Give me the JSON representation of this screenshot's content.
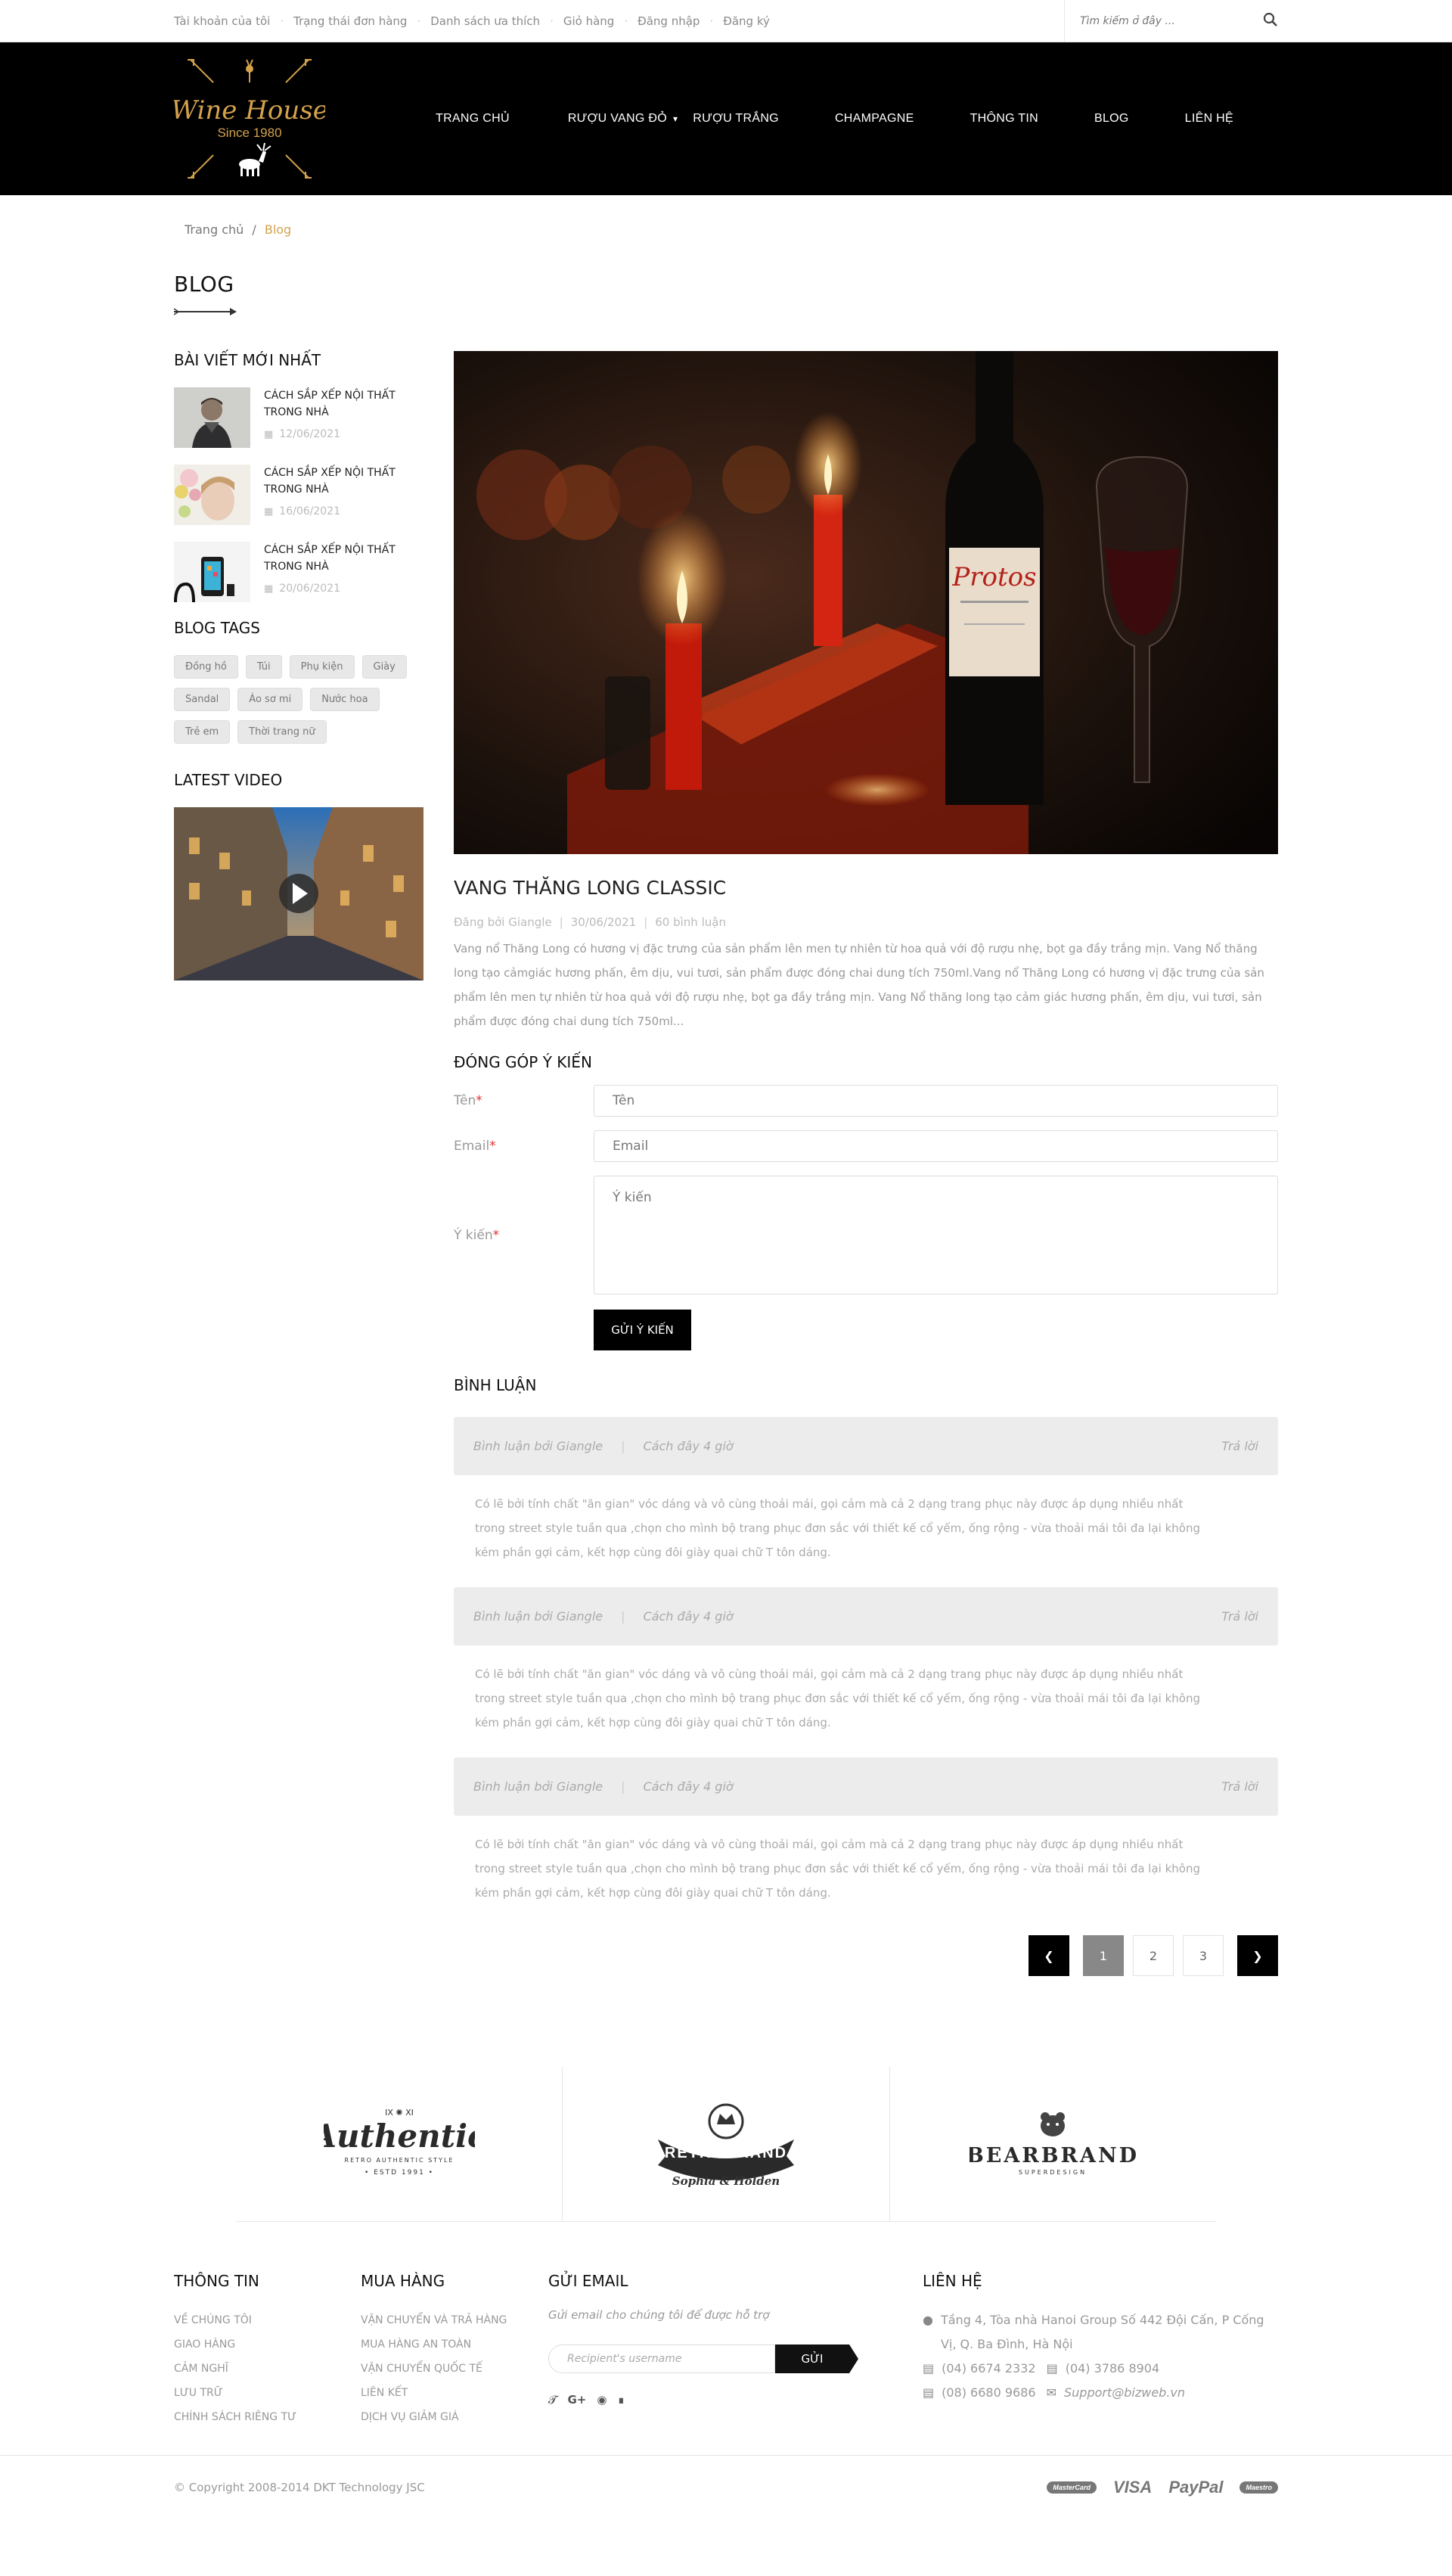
{
  "topbar": {
    "links": [
      "Tài khoản của tôi",
      "Trạng thái đơn hàng",
      "Danh sách ưa thích",
      "Giỏ hàng",
      "Đăng nhập",
      "Đăng ký"
    ],
    "search_placeholder": "Tìm kiếm ở đây ..."
  },
  "logo": {
    "name": "Wine House",
    "since": "Since 1980"
  },
  "nav": [
    "TRANG CHỦ",
    "RƯỢU VANG ĐỎ",
    "RƯỢU TRẮNG",
    "CHAMPAGNE",
    "THÔNG TIN",
    "BLOG",
    "LIÊN HỆ"
  ],
  "breadcrumb": {
    "home": "Trang chủ",
    "sep": "/",
    "current": "Blog"
  },
  "page_title": "BLOG",
  "sidebar": {
    "latest_title": "BÀI VIẾT MỚI NHẤT",
    "posts": [
      {
        "title": "CÁCH SẮP XẾP NỘI THẤT TRONG NHÀ",
        "date": "12/06/2021"
      },
      {
        "title": "CÁCH SẮP XẾP NỘI THẤT TRONG NHÀ",
        "date": "16/06/2021"
      },
      {
        "title": "CÁCH SẮP XẾP NỘI THẤT TRONG NHÀ",
        "date": "20/06/2021"
      }
    ],
    "tags_title": "BLOG TAGS",
    "tags": [
      "Đồng hồ",
      "Túi",
      "Phụ kiện",
      "Giày",
      "Sandal",
      "Áo sơ mi",
      "Nước hoa",
      "Trẻ em",
      "Thời trang nữ"
    ],
    "video_title": "LATEST VIDEO"
  },
  "article": {
    "title": "VANG THĂNG LONG CLASSIC",
    "author": "Đăng bởi Giangle",
    "date": "30/06/2021",
    "comments": "60 bình luận",
    "body": "Vang nổ Thăng Long có hương vị đặc trưng của sản phẩm lên men tự nhiên từ hoa quả với độ rượu nhẹ, bọt ga đầy trắng mịn. Vang Nổ thăng long tạo cảmgiác hương phấn, êm dịu, vui tươi, sản phẩm được đóng chai dung tích 750ml.Vang nổ Thăng Long có hương vị đặc trưng của sản phẩm lên men tự nhiên từ hoa quả với độ rượu nhẹ, bọt ga đầy trắng mịn. Vang Nổ thăng long tạo cảm giác hương phấn, êm dịu, vui tươi, sản phẩm được đóng chai dung tích 750ml..."
  },
  "form": {
    "title": "ĐÓNG GÓP Ý KIẾN",
    "name_label": "Tên",
    "name_placeholder": "Tên",
    "email_label": "Email",
    "email_placeholder": "Email",
    "msg_label": "Ý kiến",
    "msg_placeholder": "Ý kiến",
    "required": "*",
    "submit": "GỬI Ý KIẾN"
  },
  "comments": {
    "title": "BÌNH LUẬN",
    "items": [
      {
        "by": "Bình luận bởi Giangle",
        "sep": "|",
        "time": "Cách đây 4 giờ",
        "reply": "Trả lời",
        "text": "Có lẽ bởi tính chất \"ăn gian\" vóc dáng và vô cùng thoải mái, gọi cảm mà cả 2 dạng trang phục này được áp dụng nhiều nhất trong street style tuần qua ,chọn cho mình bộ trang phục đơn sắc với thiết kế cổ yếm, ống rộng - vừa thoải mái tôi đa lại không kém phần gợi cảm, kết hợp cùng đôi giày quai chữ T tôn dáng."
      },
      {
        "by": "Bình luận bởi Giangle",
        "sep": "|",
        "time": "Cách đây 4 giờ",
        "reply": "Trả lời",
        "text": "Có lẽ bởi tính chất \"ăn gian\" vóc dáng và vô cùng thoải mái, gọi cảm mà cả 2 dạng trang phục này được áp dụng nhiều nhất trong street style tuần qua ,chọn cho mình bộ trang phục đơn sắc với thiết kế cổ yếm, ống rộng - vừa thoải mái tôi đa lại không kém phần gợi cảm, kết hợp cùng đôi giày quai chữ T tôn dáng."
      },
      {
        "by": "Bình luận bởi Giangle",
        "sep": "|",
        "time": "Cách đây 4 giờ",
        "reply": "Trả lời",
        "text": "Có lẽ bởi tính chất \"ăn gian\" vóc dáng và vô cùng thoải mái, gọi cảm mà cả 2 dạng trang phục này được áp dụng nhiều nhất trong street style tuần qua ,chọn cho mình bộ trang phục đơn sắc với thiết kế cổ yếm, ống rộng - vừa thoải mái tôi đa lại không kém phần gợi cảm, kết hợp cùng đôi giày quai chữ T tôn dáng."
      }
    ]
  },
  "pagination": {
    "pages": [
      "1",
      "2",
      "3"
    ],
    "current": "1"
  },
  "brands": [
    {
      "name": "Authentic",
      "sub": "RETRO AUTHENTIC STYLE",
      "top": "IX ✺ XI",
      "est": "• ESTD 1991 •"
    },
    {
      "name": "RETROBRAND",
      "sub": "Sophia & Holden"
    },
    {
      "name": "BEARBRAND",
      "sub": "SUPERDESIGN"
    }
  ],
  "footer": {
    "info_title": "THÔNG TIN",
    "info_links": [
      "Về chúng tôi",
      "Giao hàng",
      "Cảm nghĩ",
      "Lưu trữ",
      "Chính sách riêng tư"
    ],
    "shop_title": "MUA HÀNG",
    "shop_links": [
      "Vận chuyển và trả hàng",
      "Mua hàng an toàn",
      "Vận chuyển quốc tế",
      "Liên kết",
      "Dịch vụ giảm giá"
    ],
    "mail_title": "GỬI EMAIL",
    "mail_desc": "Gửi email cho chúng tôi để được hỗ trợ",
    "mail_placeholder": "Recipient's username",
    "mail_button": "GỬI",
    "contact_title": "LIÊN HỆ",
    "address": "Tầng 4, Tòa nhà Hanoi Group Số 442 Đội Cấn, P Cống Vị, Q. Ba Đình, Hà Nội",
    "phone1": "(04) 6674 2332",
    "phone2": "(04) 3786 8904",
    "phone3": "(08) 6680 9686",
    "email": "Support@bizweb.vn",
    "copyright": "© Copyright 2008-2014 DKT Technology JSC",
    "payments": [
      "MasterCard",
      "VISA",
      "PayPal",
      "Maestro"
    ]
  },
  "colors": {
    "accent": "#d4a24c",
    "header_bg": "#000000"
  }
}
